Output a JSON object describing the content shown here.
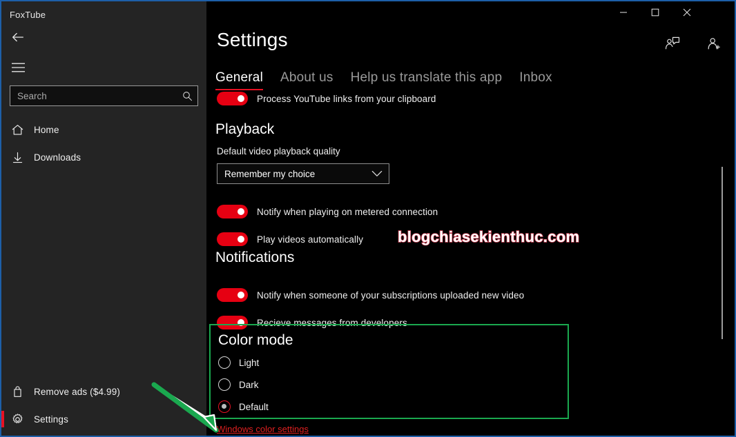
{
  "window": {
    "app_title": "FoxTube",
    "border_color": "#1d5fa8",
    "controls": {
      "minimize": "minimize-button",
      "maximize": "maximize-button",
      "close": "close-button"
    }
  },
  "sidebar": {
    "back_label": "Back",
    "menu_label": "Menu",
    "search": {
      "placeholder": "Search",
      "value": "",
      "icon": "search-icon"
    },
    "items": [
      {
        "label": "Home",
        "icon": "home-icon",
        "selected": false
      },
      {
        "label": "Downloads",
        "icon": "download-icon",
        "selected": false
      },
      {
        "label": "Remove ads ($4.99)",
        "icon": "bag-icon",
        "selected": false
      },
      {
        "label": "Settings",
        "icon": "gear-icon",
        "selected": true
      }
    ],
    "selection_color": "#e81123",
    "background": "#242424"
  },
  "header": {
    "title": "Settings",
    "icons": [
      {
        "name": "feedback-icon",
        "label": "Send feedback"
      },
      {
        "name": "account-add-icon",
        "label": "Account"
      }
    ]
  },
  "tabs": {
    "active_indicator_color": "#e81123",
    "items": [
      {
        "label": "General",
        "active": true
      },
      {
        "label": "About us",
        "active": false
      },
      {
        "label": "Help us translate this app",
        "active": false
      },
      {
        "label": "Inbox",
        "active": false
      }
    ]
  },
  "settings": {
    "clipboard_toggle": {
      "label": "Process YouTube links from your clipboard",
      "on": true
    },
    "playback": {
      "heading": "Playback",
      "quality_label": "Default video playback quality",
      "quality_value": "Remember my choice",
      "quality_options": [
        "Remember my choice"
      ],
      "toggles": [
        {
          "label": "Notify when playing on metered connection",
          "on": true
        },
        {
          "label": "Play videos automatically",
          "on": true
        }
      ]
    },
    "notifications": {
      "heading": "Notifications",
      "toggles": [
        {
          "label": "Notify when someone of your subscriptions uploaded new video",
          "on": true
        },
        {
          "label": "Recieve messages from developers",
          "on": true
        }
      ]
    },
    "color_mode": {
      "heading": "Color mode",
      "highlight_color": "#1aa84f",
      "options": [
        {
          "label": "Light",
          "selected": false
        },
        {
          "label": "Dark",
          "selected": false
        },
        {
          "label": "Default",
          "selected": true
        }
      ],
      "link_label": "Windows color settings",
      "link_color": "#e02020"
    },
    "toggle_on_color": "#e60012"
  },
  "annotations": {
    "arrow_color": "#1aa84f",
    "watermark": "blogchiasekienthuc.com"
  }
}
